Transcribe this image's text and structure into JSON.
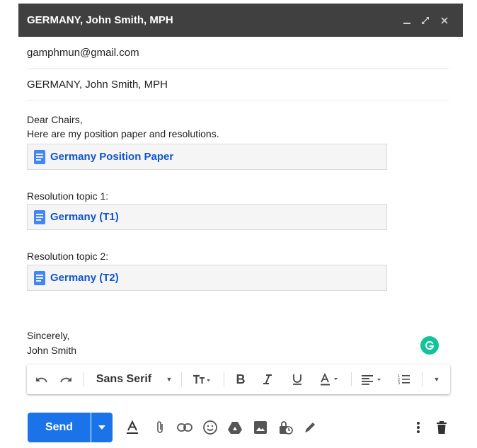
{
  "window": {
    "title": "GERMANY, John Smith, MPH"
  },
  "recipients": {
    "to": "gamphmun@gmail.com"
  },
  "subject": {
    "value": "GERMANY, John Smith, MPH"
  },
  "body": {
    "greeting": "Dear Chairs,",
    "intro": "Here are my position paper and resolutions.",
    "attachments": [
      {
        "label": "Germany Position Paper"
      },
      {
        "label": "Germany (T1)"
      },
      {
        "label": "Germany (T2)"
      }
    ],
    "topic1_label": "Resolution topic 1:",
    "topic2_label": "Resolution topic 2:",
    "closing": "Sincerely,",
    "signature": "John Smith"
  },
  "toolbar": {
    "font": "Sans Serif",
    "icons": [
      "undo-icon",
      "redo-icon",
      "font-size-icon",
      "bold-icon",
      "italic-icon",
      "underline-icon",
      "text-color-icon",
      "align-icon",
      "numbered-list-icon",
      "more-formatting-icon"
    ]
  },
  "bottom": {
    "send_label": "Send",
    "icons": [
      "formatting-icon",
      "attach-icon",
      "link-icon",
      "emoji-icon",
      "drive-icon",
      "photo-icon",
      "confidential-icon",
      "signature-icon",
      "more-options-icon",
      "delete-icon"
    ]
  },
  "colors": {
    "titlebar": "#404040",
    "accent": "#1a73e8",
    "chip_link": "#1155cc",
    "doc_icon": "#4285f4",
    "grammarly": "#15c39a"
  }
}
